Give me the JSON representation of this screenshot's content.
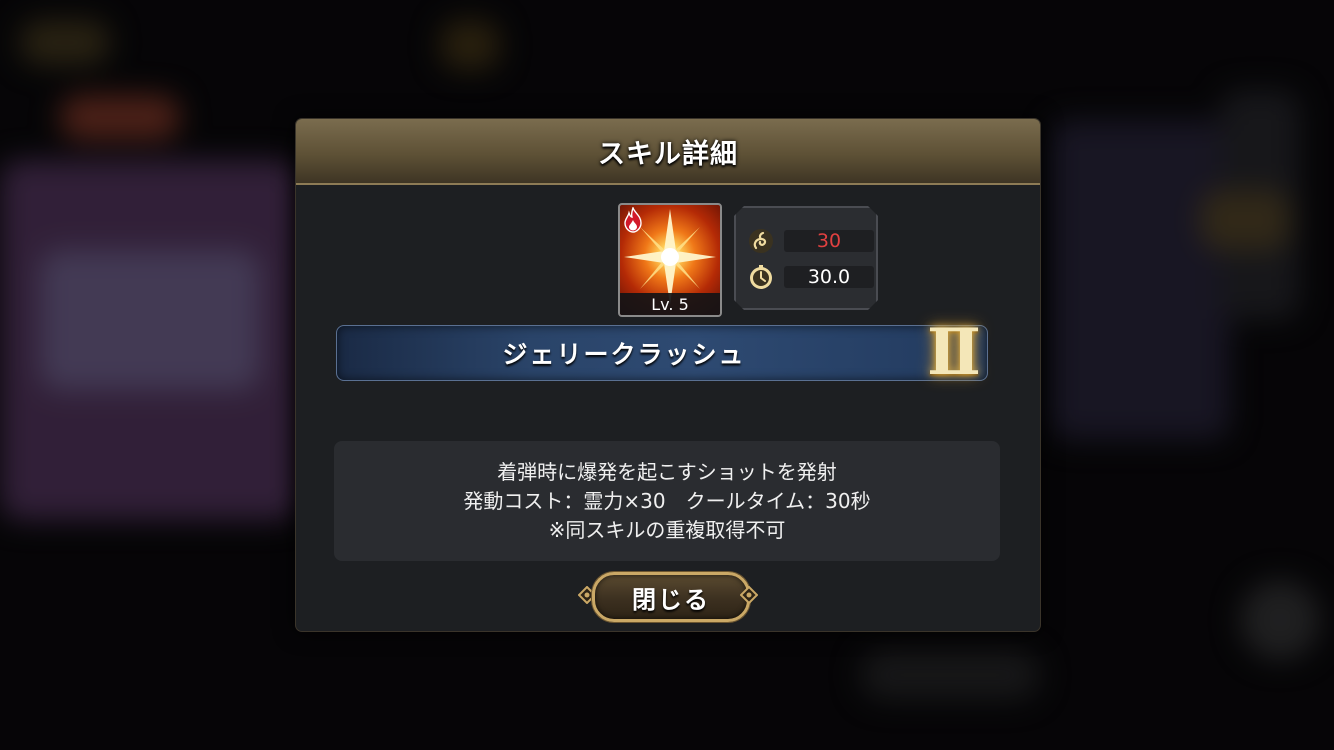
{
  "dialog": {
    "title": "スキル詳細",
    "skill": {
      "level": "Lv. 5",
      "cost": "30",
      "cooldown": "30.0",
      "name": "ジェリークラッシュ",
      "rank": "Ⅱ",
      "element_icon": "fire-icon",
      "cost_icon": "spirit-icon",
      "cooldown_icon": "stopwatch-icon"
    },
    "description": [
      "着弾時に爆発を起こすショットを発射",
      "発動コスト：霊力×30　クールタイム：30秒",
      "※同スキルの重複取得不可"
    ],
    "close_label": "閉じる"
  },
  "colors": {
    "header_gold": "#6b5d40",
    "cost_red": "#e04040",
    "banner_blue": "#2a4469",
    "rank_gold": "#f4e7b8"
  }
}
